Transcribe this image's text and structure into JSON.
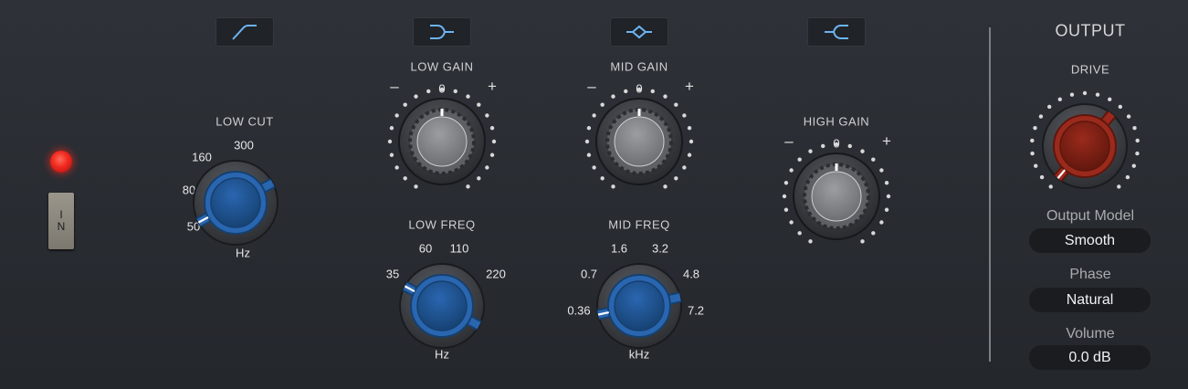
{
  "power": {
    "led_color": "#f0281e",
    "in_label_top": "I",
    "in_label_bottom": "N"
  },
  "filter_buttons": [
    {
      "icon": "low-cut-curve-icon"
    },
    {
      "icon": "low-shelf-curve-icon"
    },
    {
      "icon": "mid-peak-curve-icon"
    },
    {
      "icon": "high-shelf-curve-icon"
    }
  ],
  "low_cut": {
    "label": "LOW CUT",
    "unit": "Hz",
    "scale": [
      "50",
      "80",
      "160",
      "300"
    ],
    "value": "50"
  },
  "low_gain": {
    "label": "LOW GAIN",
    "minus": "–",
    "zero": "0",
    "plus": "+",
    "value": 0
  },
  "low_freq": {
    "label": "LOW FREQ",
    "unit": "Hz",
    "scale": [
      "35",
      "60",
      "110",
      "220"
    ],
    "value": "35"
  },
  "mid_gain": {
    "label": "MID GAIN",
    "minus": "–",
    "zero": "0",
    "plus": "+",
    "value": 0
  },
  "mid_freq": {
    "label": "MID FREQ",
    "unit": "kHz",
    "scale": [
      "0.36",
      "0.7",
      "1.6",
      "3.2",
      "4.8",
      "7.2"
    ],
    "value": "0.36"
  },
  "high_gain": {
    "label": "HIGH GAIN",
    "minus": "–",
    "zero": "0",
    "plus": "+",
    "value": 0
  },
  "output": {
    "title": "OUTPUT",
    "drive_label": "DRIVE",
    "drive_value": "min",
    "output_model_label": "Output Model",
    "output_model_value": "Smooth",
    "phase_label": "Phase",
    "phase_value": "Natural",
    "volume_label": "Volume",
    "volume_value": "0.0 dB"
  },
  "colors": {
    "blue_knob": "#2a66b0",
    "red_knob": "#9a2a1c",
    "icon_blue": "#6db4f2"
  }
}
